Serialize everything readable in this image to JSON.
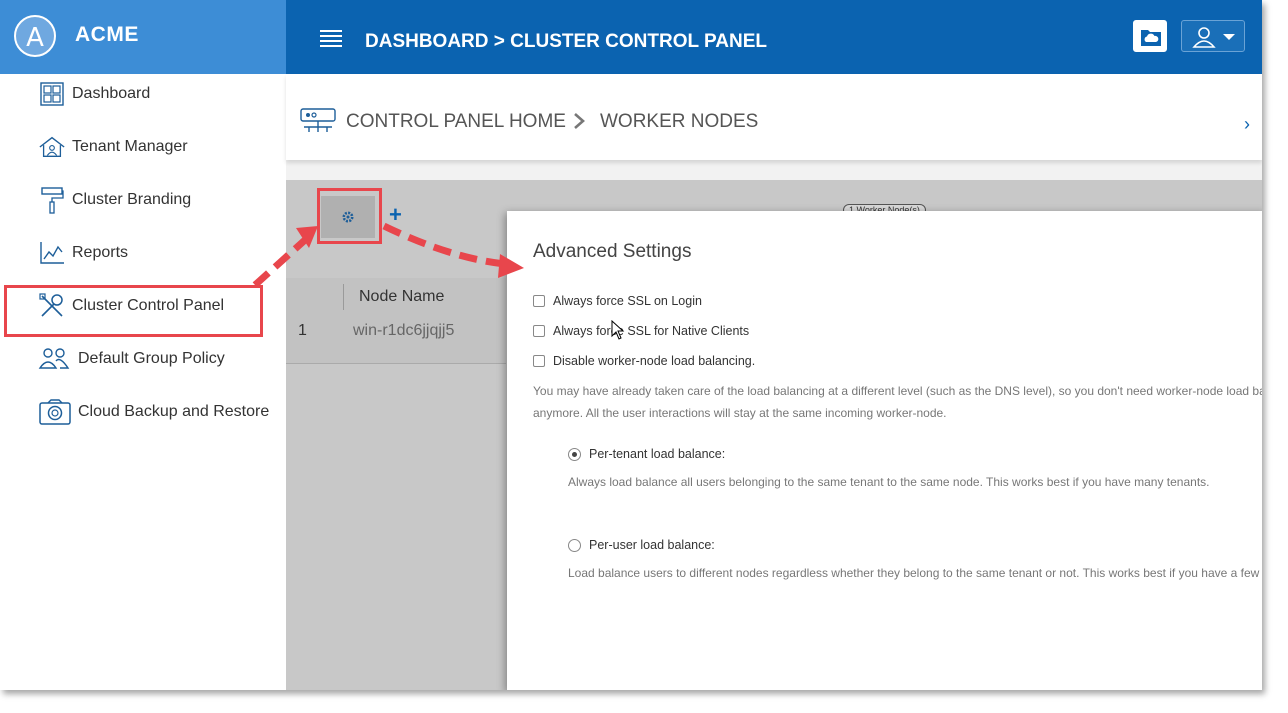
{
  "brand": {
    "logo_letter": "A",
    "name": "ACME"
  },
  "topbar": {
    "title": "DASHBOARD > CLUSTER CONTROL PANEL"
  },
  "sidebar": {
    "items": [
      {
        "label": "Dashboard",
        "icon": "dashboard-icon"
      },
      {
        "label": "Tenant Manager",
        "icon": "tenant-house-icon"
      },
      {
        "label": "Cluster Branding",
        "icon": "paint-roller-icon"
      },
      {
        "label": "Reports",
        "icon": "chart-icon"
      },
      {
        "label": "Cluster Control Panel",
        "icon": "tools-icon"
      },
      {
        "label": "Default Group Policy",
        "icon": "users-icon"
      },
      {
        "label": "Cloud Backup and Restore",
        "icon": "camera-icon"
      }
    ],
    "highlighted": "Cluster Control Panel"
  },
  "breadcrumb": {
    "home": "CONTROL PANEL HOME",
    "current": "WORKER NODES"
  },
  "toolbar": {
    "node_count": "1 Worker Node(s)"
  },
  "table": {
    "columns": [
      "",
      "Node Name"
    ],
    "rows": [
      {
        "num": "1",
        "name": "win-r1dc6jjqjj5"
      }
    ]
  },
  "modal": {
    "title": "Advanced Settings",
    "checkboxes": [
      {
        "label": "Always force SSL on Login",
        "checked": false
      },
      {
        "label": "Always force SSL for Native Clients",
        "checked": false
      },
      {
        "label": "Disable worker-node load balancing.",
        "checked": false
      }
    ],
    "note_line1": "You may have already taken care of the load balancing at a different level (such as the DNS level), so you don't need worker-node load balancing",
    "note_line2": "anymore. All the user interactions will stay at the same incoming worker-node.",
    "radios": [
      {
        "label": "Per-tenant load balance:",
        "selected": true,
        "description": "Always load balance all users belonging to the same tenant to the same node. This works best if you have many tenants."
      },
      {
        "label": "Per-user load balance:",
        "selected": false,
        "description": "Load balance users to different nodes regardless whether they belong to the same tenant or not. This works best if you have a few large tenants."
      }
    ]
  },
  "colors": {
    "topbar": "#0b63b0",
    "brand": "#3d8dd6",
    "accent": "#0b63b0",
    "annotation": "#e8464c"
  }
}
